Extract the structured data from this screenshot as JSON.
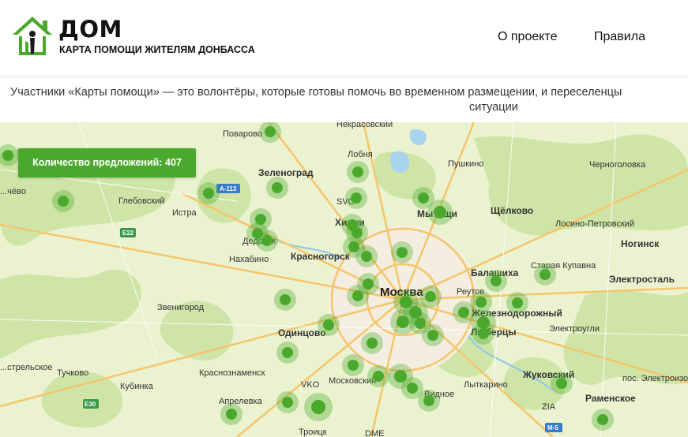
{
  "header": {
    "logo_title": "ДОМ",
    "logo_subtitle": "КАРТА ПОМОЩИ ЖИТЕЛЯМ ДОНБАССА",
    "nav": [
      {
        "label": "О проекте"
      },
      {
        "label": "Правила"
      }
    ]
  },
  "intro": {
    "line1": "Участники «Карты помощи» — это волонтёры, которые готовы помочь во временном размещении, и переселенцы",
    "line2": "ситуации"
  },
  "map": {
    "count_label": "Количество предложений: 407",
    "center_city": "Москва",
    "place_labels": [
      "Некрасовский",
      "Поварово",
      "Лобня",
      "Пушкино",
      "Черноголовка",
      "Зеленоград",
      "Мытищи",
      "Щёлково",
      "Лосино-Петровский",
      "Глебовский",
      "Истра",
      "Химки",
      "Дедовск",
      "Нахабино",
      "Красногорск",
      "Ногинск",
      "Балашиха",
      "Старая Купавна",
      "Электросталь",
      "Реутов",
      "Железнодорожный",
      "Звенигород",
      "Одинцово",
      "Люберцы",
      "Электроугли",
      "Тучково",
      "Краснознаменск",
      "Кубинка",
      "Жуковский",
      "Раменское",
      "Московский",
      "Видное",
      "Лыткарино",
      "Апрелевка",
      "Троицк",
      "пос. Электроизоляционный",
      "...чёво",
      "...стрельское"
    ],
    "road_shields": [
      "A-113",
      "E22",
      "E30",
      "M-5"
    ],
    "airports": [
      "SVO",
      "VKO",
      "ZIA",
      "DME"
    ],
    "marker_color": "#4aa92c"
  },
  "colors": {
    "brand_green": "#4aa92c",
    "map_bg": "#eaf2cf",
    "road": "#f5c56b"
  }
}
